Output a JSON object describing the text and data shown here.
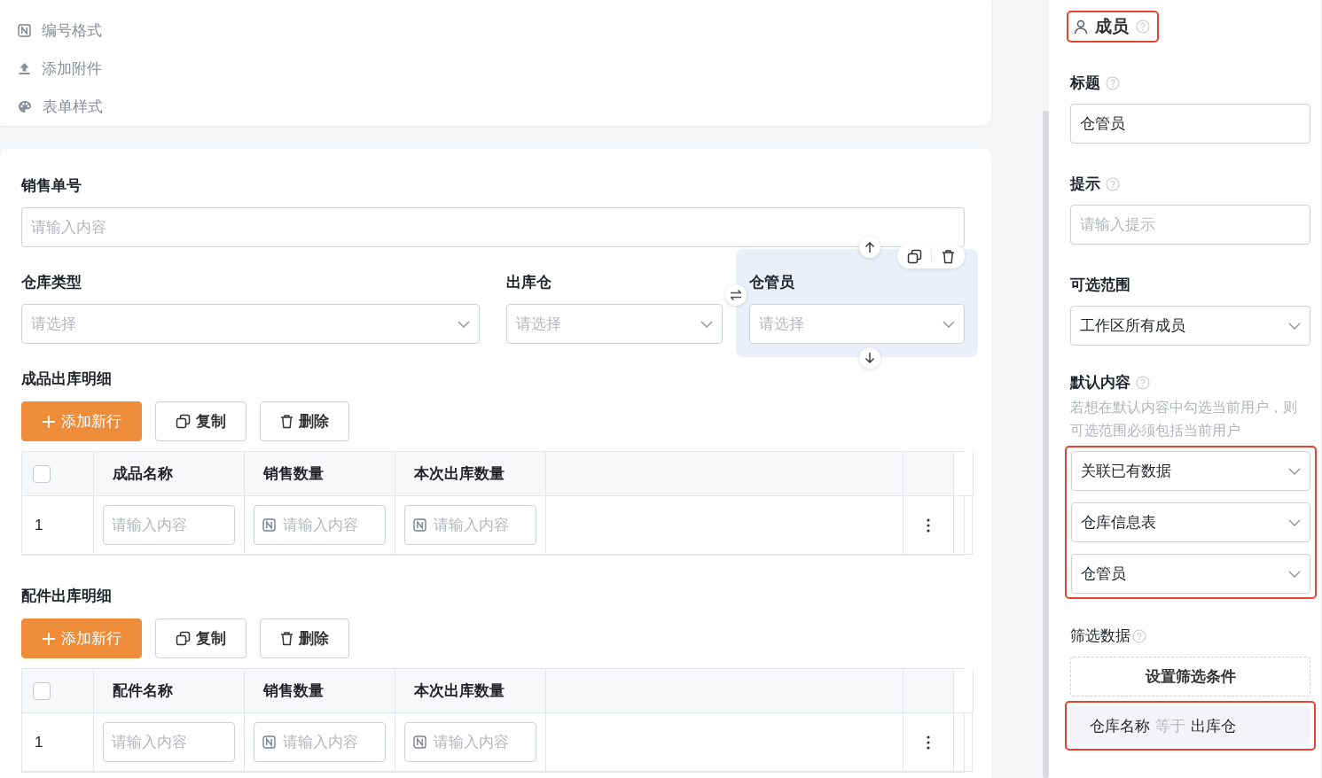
{
  "top_menu": [
    {
      "kind": "numbering",
      "label": "编号格式"
    },
    {
      "kind": "upload",
      "label": "添加附件"
    },
    {
      "kind": "palette",
      "label": "表单样式"
    }
  ],
  "form": {
    "rows": [
      {
        "fields": [
          {
            "label": "销售单号",
            "kind": "input",
            "placeholder": "请输入内容",
            "selected": false
          }
        ]
      },
      {
        "fields": [
          {
            "label": "仓库类型",
            "kind": "select",
            "placeholder": "请选择",
            "selected": false
          },
          {
            "label": "出库仓",
            "kind": "select",
            "placeholder": "请选择",
            "selected": false
          },
          {
            "label": "仓管员",
            "kind": "select",
            "placeholder": "请选择",
            "selected": true
          }
        ]
      }
    ]
  },
  "tables": [
    {
      "title": "成品出库明细",
      "buttons": [
        {
          "kind": "add",
          "label": "添加新行"
        },
        {
          "kind": "copy",
          "label": "复制"
        },
        {
          "kind": "delete",
          "label": "删除"
        }
      ],
      "all_checked": false,
      "columns": [
        "成品名称",
        "销售数量",
        "本次出库数量"
      ],
      "rows": [
        {
          "index": "1",
          "cells": [
            {
              "kind": "text",
              "placeholder": "请输入内容"
            },
            {
              "kind": "number",
              "placeholder": "请输入内容"
            },
            {
              "kind": "number",
              "placeholder": "请输入内容"
            }
          ]
        }
      ]
    },
    {
      "title": "配件出库明细",
      "buttons": [
        {
          "kind": "add",
          "label": "添加新行"
        },
        {
          "kind": "copy",
          "label": "复制"
        },
        {
          "kind": "delete",
          "label": "删除"
        }
      ],
      "all_checked": false,
      "columns": [
        "配件名称",
        "销售数量",
        "本次出库数量"
      ],
      "rows": [
        {
          "index": "1",
          "cells": [
            {
              "kind": "text",
              "placeholder": "请输入内容"
            },
            {
              "kind": "number",
              "placeholder": "请输入内容"
            },
            {
              "kind": "number",
              "placeholder": "请输入内容"
            }
          ]
        }
      ]
    }
  ],
  "side_panel": {
    "header": {
      "title": "成员",
      "highlighted": true
    },
    "fields": [
      {
        "kind": "input",
        "label": "标题",
        "help": true,
        "value": "仓管员"
      },
      {
        "kind": "input",
        "label": "提示",
        "help": true,
        "placeholder": "请输入提示"
      },
      {
        "kind": "select",
        "label": "可选范围",
        "help": false,
        "value": "工作区所有成员"
      }
    ],
    "default_content": {
      "label": "默认内容",
      "help": true,
      "note": "若想在默认内容中勾选当前用户，则可选范围必须包括当前用户",
      "selects": [
        "关联已有数据",
        "仓库信息表",
        "仓管员"
      ],
      "highlighted": true
    },
    "filter": {
      "label": "筛选数据",
      "help": true,
      "button": "设置筛选条件",
      "condition": {
        "field": "仓库名称",
        "operator": "等于",
        "value": "出库仓"
      },
      "highlighted": true
    }
  }
}
